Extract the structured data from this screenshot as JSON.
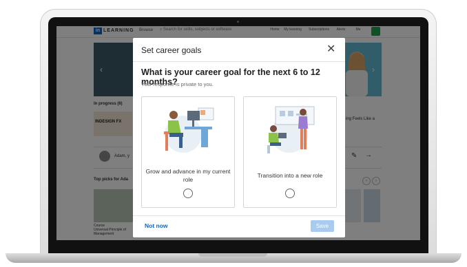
{
  "app": {
    "logo_letters": "in",
    "logo_text": "LEARNING",
    "nav_browse": "Browse",
    "search_placeholder": "Search for skills, subjects or software",
    "nav_items": [
      "Home",
      "My learning",
      "Subscriptions",
      "Alerts",
      "Me"
    ],
    "in_progress": "In progress (6)",
    "course_card": "INDESIGN FX",
    "side_text": "ing Feels Like a",
    "row_author": "Adam, y",
    "top_picks": "Top picks for Ada",
    "thumb_caption": "Course\nUniversal Principle of\nManagement"
  },
  "modal": {
    "title": "Set career goals",
    "close_glyph": "✕",
    "question": "What is your career goal for the next 6 to 12 months?",
    "subtext": "Your response is private to you.",
    "options": [
      {
        "label": "Grow and advance in my current role"
      },
      {
        "label": "Transition into a new role"
      }
    ],
    "not_now": "Not now",
    "save": "Save"
  },
  "colors": {
    "accent": "#0a66c2",
    "save_disabled": "#a9cbef",
    "overlay": "rgba(0,0,0,0.5)"
  }
}
